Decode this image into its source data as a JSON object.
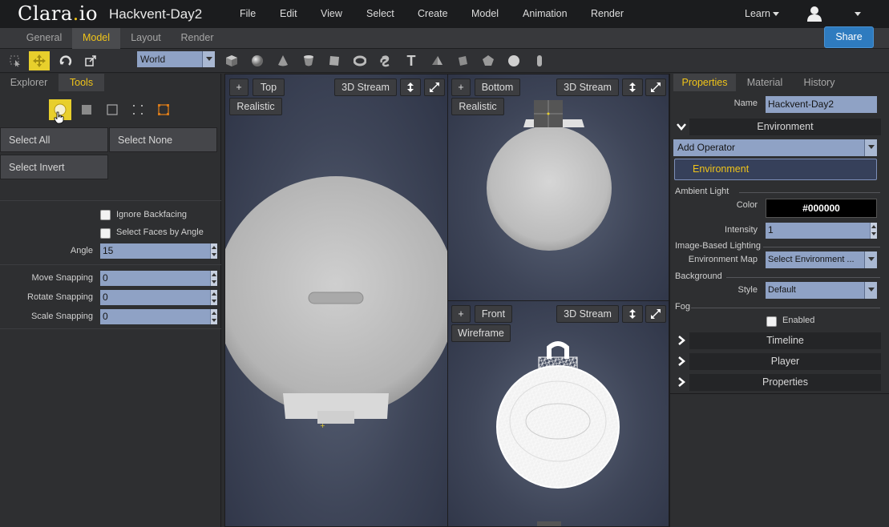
{
  "app": {
    "logo_text_main": "Clara",
    "logo_text_dot": ".",
    "logo_text_tld": "io",
    "filename": "Hackvent-Day2"
  },
  "menubar": {
    "items": [
      {
        "label": "File"
      },
      {
        "label": "Edit"
      },
      {
        "label": "View"
      },
      {
        "label": "Select"
      },
      {
        "label": "Create"
      },
      {
        "label": "Model"
      },
      {
        "label": "Animation"
      },
      {
        "label": "Render"
      }
    ],
    "learn": "Learn",
    "share": "Share"
  },
  "mode_tabs": [
    {
      "label": "General",
      "active": false
    },
    {
      "label": "Model",
      "active": true
    },
    {
      "label": "Layout",
      "active": false
    },
    {
      "label": "Render",
      "active": false
    }
  ],
  "toolbar": {
    "coordinate_space": "World",
    "tools": [
      "select-icon",
      "move-icon",
      "rotate-icon",
      "scale-icon"
    ],
    "primitives": [
      "cube-icon",
      "sphere-icon",
      "cone-icon",
      "cylinder-icon",
      "plane-icon",
      "torus-icon",
      "knot-icon",
      "text-icon",
      "pyramid-icon",
      "box-icon",
      "dodecahedron-icon",
      "ball-icon",
      "capsule-icon"
    ],
    "text_tool_glyph": "T"
  },
  "left_panel": {
    "tabs": [
      {
        "label": "Explorer",
        "active": false
      },
      {
        "label": "Tools",
        "active": true
      }
    ],
    "select_buttons": {
      "select_all": "Select All",
      "select_none": "Select None",
      "select_invert": "Select Invert"
    },
    "options": {
      "ignore_backfacing": "Ignore Backfacing",
      "select_faces_by_angle": "Select Faces by Angle",
      "angle_label": "Angle",
      "angle_value": "15"
    },
    "snapping": {
      "move_label": "Move Snapping",
      "move_value": "0",
      "rotate_label": "Rotate Snapping",
      "rotate_value": "0",
      "scale_label": "Scale Snapping",
      "scale_value": "0"
    }
  },
  "viewports": {
    "top": {
      "plus": "+",
      "view": "Top",
      "stream": "3D Stream",
      "shading": "Realistic"
    },
    "bottom": {
      "plus": "+",
      "view": "Bottom",
      "stream": "3D Stream",
      "shading": "Realistic"
    },
    "front": {
      "plus": "+",
      "view": "Front",
      "stream": "3D Stream",
      "shading": "Wireframe"
    }
  },
  "right_panel": {
    "tabs": [
      {
        "label": "Properties",
        "active": true
      },
      {
        "label": "Material",
        "active": false
      },
      {
        "label": "History",
        "active": false
      }
    ],
    "name_label": "Name",
    "name_value": "Hackvent-Day2",
    "environment_header": "Environment",
    "add_operator": "Add Operator",
    "environment_item": "Environment",
    "ambient_light": {
      "section": "Ambient Light",
      "color_label": "Color",
      "color_value": "#000000",
      "intensity_label": "Intensity",
      "intensity_value": "1"
    },
    "ibl": {
      "section": "Image-Based Lighting",
      "env_map_label": "Environment Map",
      "env_map_value": "Select Environment ..."
    },
    "background": {
      "section": "Background",
      "style_label": "Style",
      "style_value": "Default"
    },
    "fog": {
      "section": "Fog",
      "enabled_label": "Enabled"
    },
    "collapsed_groups": [
      "Timeline",
      "Player",
      "Properties"
    ]
  },
  "colors": {
    "accent": "#f0c419",
    "share_button": "#2e7bbf",
    "input_bg": "#8fa2c5"
  }
}
